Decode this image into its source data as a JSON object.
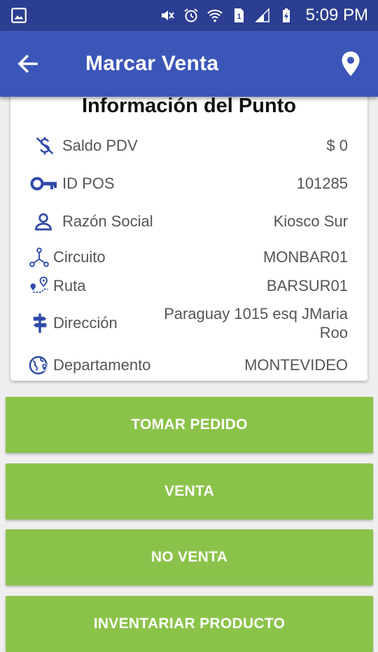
{
  "status_bar": {
    "time": "5:09 PM",
    "icons": [
      "image-icon",
      "mute-icon",
      "alarm-icon",
      "wifi-icon",
      "sim-icon",
      "signal-icon",
      "battery-icon"
    ]
  },
  "app_bar": {
    "title": "Marcar Venta",
    "back_icon": "arrow-back-icon",
    "location_icon": "location-pin-icon"
  },
  "point_info": {
    "title": "Información del Punto",
    "rows": [
      {
        "icon": "dollar-off-icon",
        "label": "Saldo PDV",
        "value": "$ 0"
      },
      {
        "icon": "key-icon",
        "label": "ID POS",
        "value": "101285"
      },
      {
        "icon": "person-icon",
        "label": "Razón Social",
        "value": "Kiosco Sur"
      },
      {
        "icon": "circuit-icon",
        "label": "Circuito",
        "value": "MONBAR01"
      },
      {
        "icon": "route-icon",
        "label": "Ruta",
        "value": "BARSUR01"
      },
      {
        "icon": "signpost-icon",
        "label": "Dirección",
        "value": "Paraguay 1015 esq  JMaria Roo"
      },
      {
        "icon": "globe-pin-icon",
        "label": "Departamento",
        "value": "MONTEVIDEO"
      }
    ]
  },
  "actions": {
    "tomar_pedido": "TOMAR PEDIDO",
    "venta": "VENTA",
    "no_venta": "NO VENTA",
    "inventariar_producto": "INVENTARIAR PRODUCTO"
  },
  "colors": {
    "status_bar": "#2c3e91",
    "app_bar": "#3b56b8",
    "icon_blue": "#2f4aa8",
    "button_green": "#8bc34a"
  }
}
